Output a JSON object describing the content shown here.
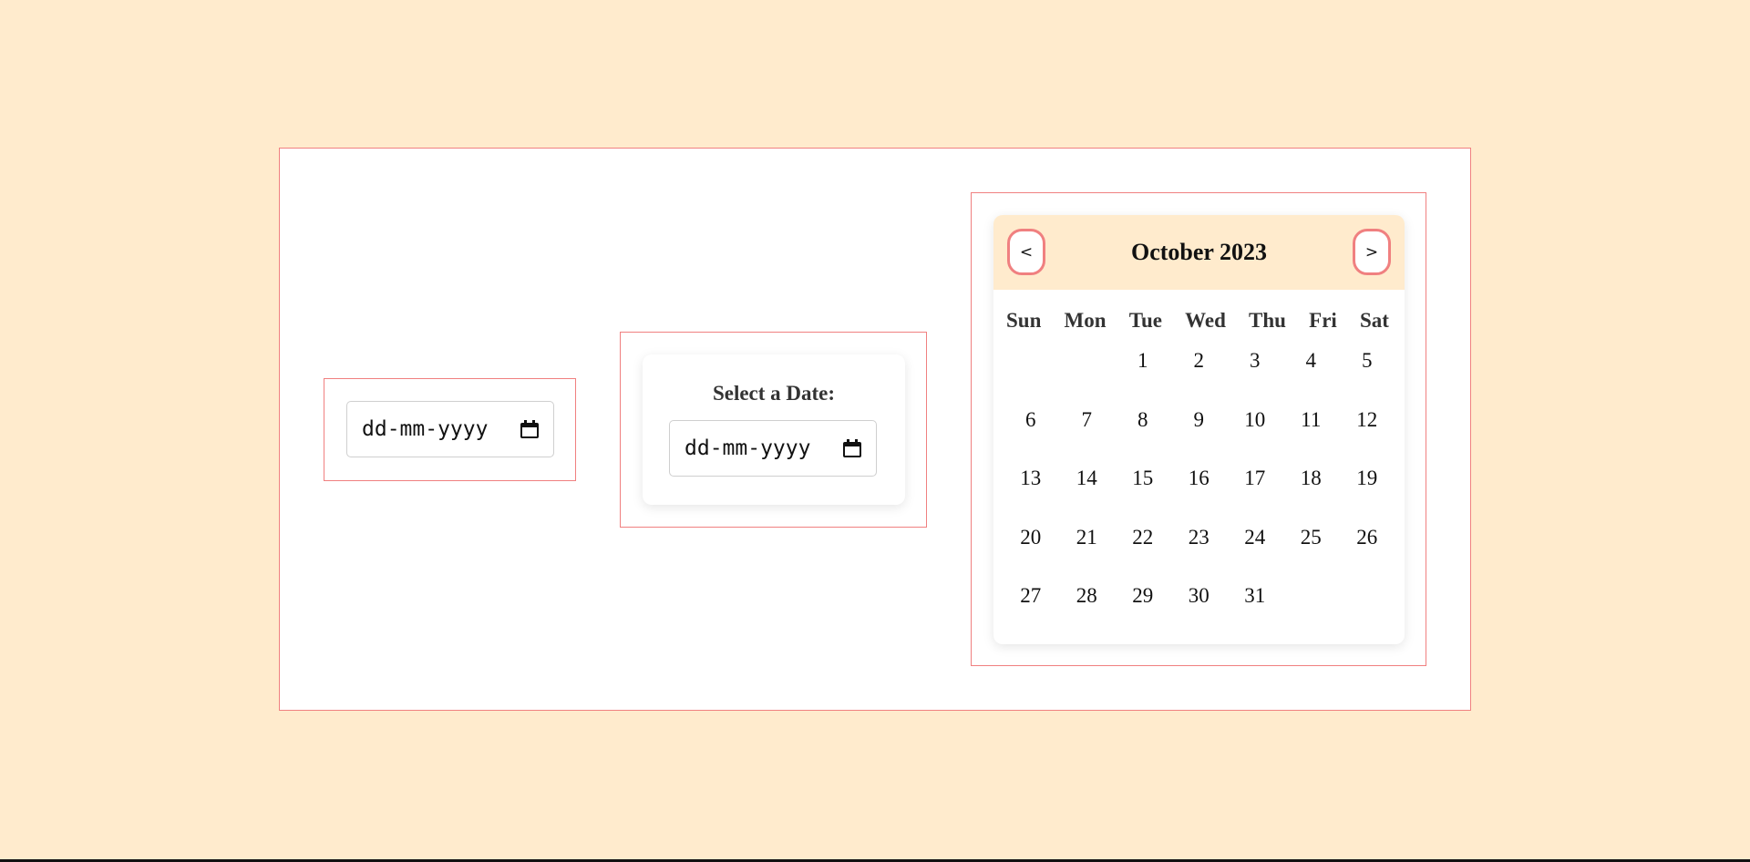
{
  "date_input_1": {
    "value_placeholder": "dd-mm-yyyy",
    "icon": "calendar-icon"
  },
  "date_card": {
    "label": "Select a Date:",
    "value_placeholder": "dd-mm-yyyy",
    "icon": "calendar-icon"
  },
  "calendar": {
    "title": "October 2023",
    "prev_label": "<",
    "next_label": ">",
    "weekdays": [
      "Sun",
      "Mon",
      "Tue",
      "Wed",
      "Thu",
      "Fri",
      "Sat"
    ],
    "leading_blanks": 0,
    "days": [
      "",
      "",
      "1",
      "2",
      "3",
      "4",
      "5",
      "6",
      "7",
      "8",
      "9",
      "10",
      "11",
      "12",
      "13",
      "14",
      "15",
      "16",
      "17",
      "18",
      "19",
      "20",
      "21",
      "22",
      "23",
      "24",
      "25",
      "26",
      "27",
      "28",
      "29",
      "30",
      "31"
    ]
  },
  "colors": {
    "background": "#ffebcd",
    "accent": "#f08080",
    "header_bg": "#ffebcd"
  }
}
